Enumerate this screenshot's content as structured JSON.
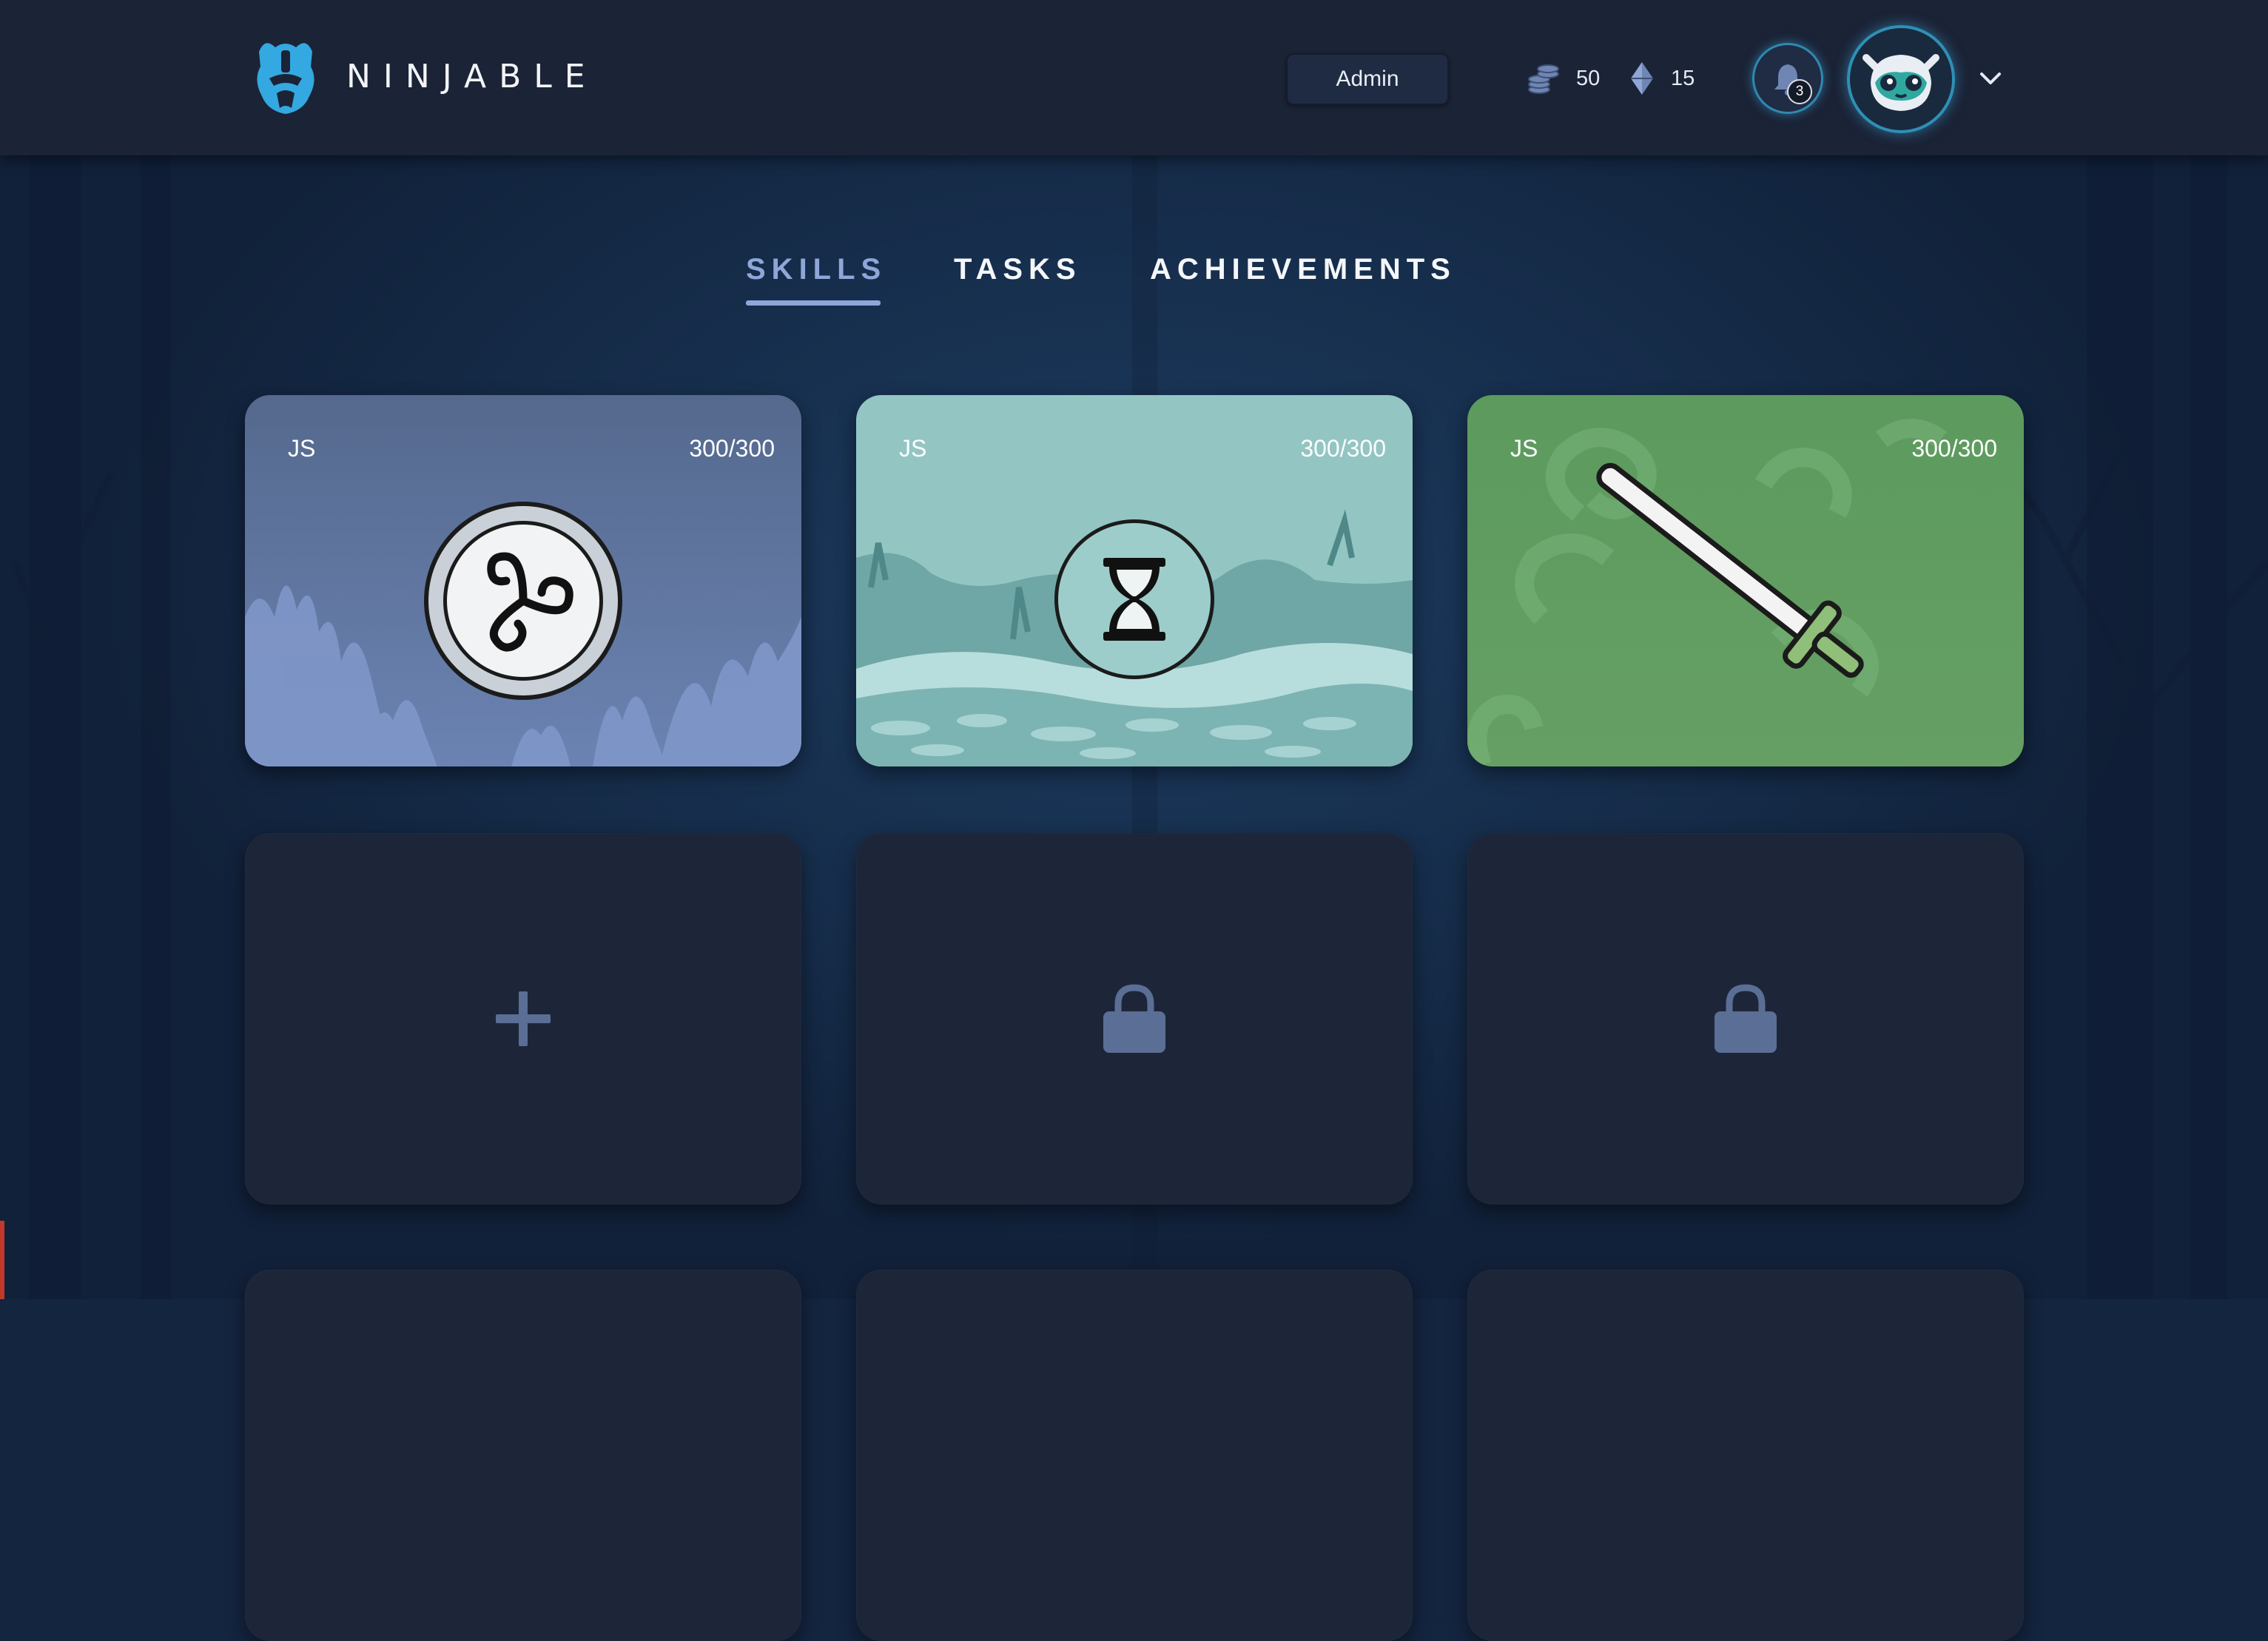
{
  "app": {
    "brand": "NINJABLE"
  },
  "header": {
    "admin_label": "Admin",
    "coins": "50",
    "gems": "15",
    "notifications_count": "3",
    "menu_icon": "chevron-down-icon"
  },
  "tabs": [
    {
      "label": "SKILLS",
      "active": true
    },
    {
      "label": "TASKS",
      "active": false
    },
    {
      "label": "ACHIEVEMENTS",
      "active": false
    }
  ],
  "skills": [
    {
      "label": "JS",
      "score": "300/300",
      "icon": "triskelion-icon",
      "theme": "fire",
      "color": "#5f7aa8"
    },
    {
      "label": "JS",
      "score": "300/300",
      "icon": "hourglass-icon",
      "theme": "water",
      "color": "#93c5c3"
    },
    {
      "label": "JS",
      "score": "300/300",
      "icon": "sword-icon",
      "theme": "wind",
      "color": "#5d9a5f"
    }
  ],
  "slots": [
    {
      "state": "add",
      "icon": "plus-icon"
    },
    {
      "state": "locked",
      "icon": "lock-icon"
    },
    {
      "state": "locked",
      "icon": "lock-icon"
    }
  ],
  "colors": {
    "header_bg": "#1b2336",
    "accent": "#8ea6d8",
    "glow": "#2f8fb6",
    "empty_card": "#1d2639"
  }
}
